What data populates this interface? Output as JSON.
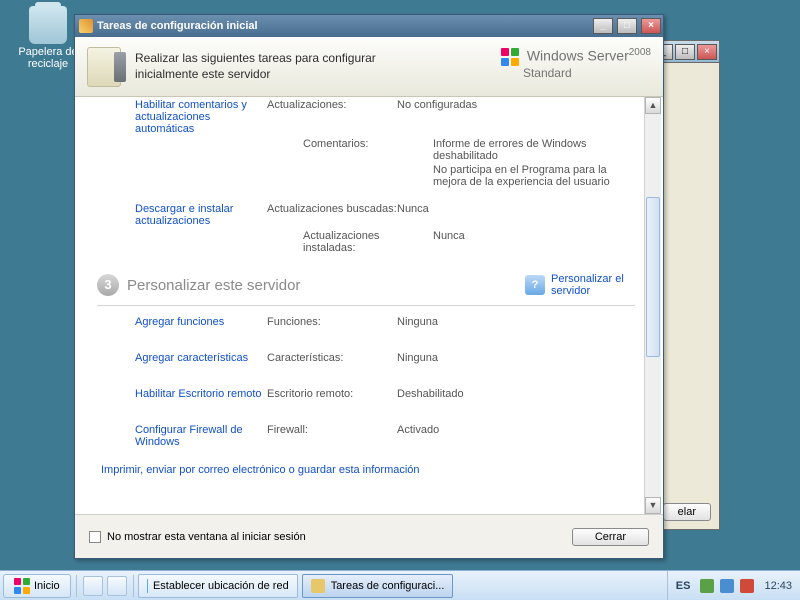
{
  "desktop": {
    "recycle_bin": "Papelera de reciclaje"
  },
  "bg_window": {
    "button": "elar"
  },
  "window": {
    "title": "Tareas de configuración inicial",
    "header_text": "Realizar las siguientes tareas para configurar inicialmente este servidor",
    "brand": {
      "name": "Windows Server",
      "year": "2008",
      "edition": "Standard"
    },
    "tasks": {
      "comments": {
        "link": "Habilitar comentarios y actualizaciones automáticas",
        "label_updates": "Actualizaciones:",
        "val_updates": "No configuradas",
        "label_comments": "Comentarios:",
        "val_comments1": "Informe de errores de Windows deshabilitado",
        "val_comments2": "No participa en el Programa para la mejora de la experiencia del usuario"
      },
      "download": {
        "link": "Descargar e instalar actualizaciones",
        "label_searched": "Actualizaciones buscadas:",
        "val_searched": "Nunca",
        "label_installed": "Actualizaciones instaladas:",
        "val_installed": "Nunca"
      }
    },
    "section3": {
      "number": "3",
      "title": "Personalizar este servidor",
      "help_link": "Personalizar el servidor"
    },
    "customize": {
      "roles": {
        "link": "Agregar funciones",
        "label": "Funciones:",
        "value": "Ninguna"
      },
      "feats": {
        "link": "Agregar características",
        "label": "Características:",
        "value": "Ninguna"
      },
      "rdp": {
        "link": "Habilitar Escritorio remoto",
        "label": "Escritorio remoto:",
        "value": "Deshabilitado"
      },
      "fw": {
        "link": "Configurar Firewall de Windows",
        "label": "Firewall:",
        "value": "Activado"
      }
    },
    "print_link": "Imprimir, enviar por correo electrónico o guardar esta información",
    "dont_show": "No mostrar esta ventana al iniciar sesión",
    "close_btn": "Cerrar"
  },
  "taskbar": {
    "start": "Inicio",
    "task1": "Establecer ubicación de red",
    "task2": "Tareas de configuraci...",
    "lang": "ES",
    "clock": "12:43"
  }
}
